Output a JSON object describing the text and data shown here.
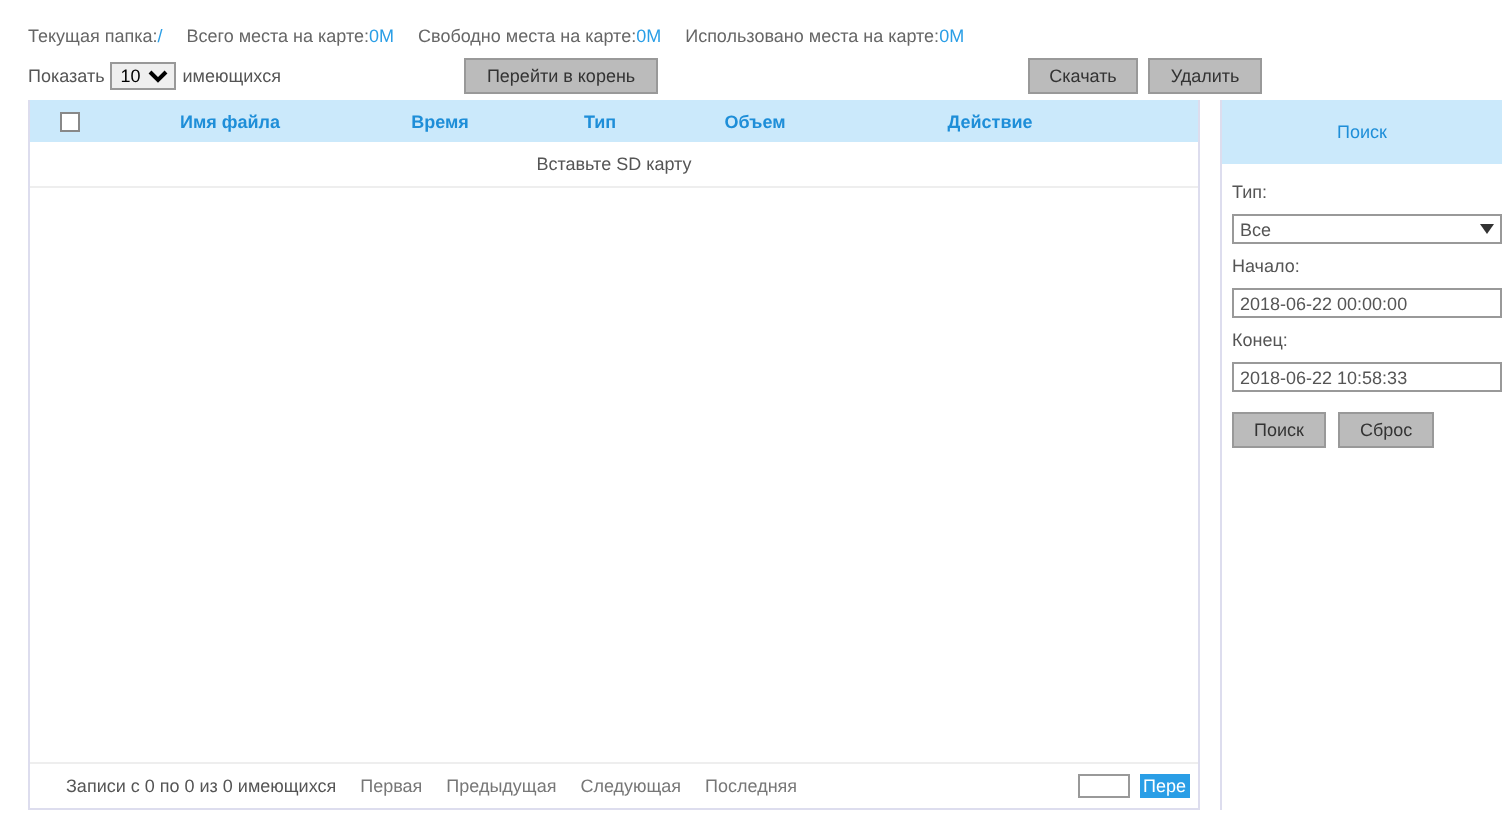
{
  "info": [
    {
      "label": "Текущая папка:",
      "value": "/"
    },
    {
      "label": "Всего места на карте:",
      "value": "0M"
    },
    {
      "label": "Свободно места на карте:",
      "value": "0M"
    },
    {
      "label": "Использовано места на карте:",
      "value": "0M"
    }
  ],
  "show": {
    "before": "Показать",
    "value": "10",
    "after": "имеющихся"
  },
  "buttons": {
    "root": "Перейти в корень",
    "download": "Скачать",
    "delete": "Удалить"
  },
  "table": {
    "select_all": {
      "checked": false
    },
    "columns": [
      "Имя файла",
      "Время",
      "Тип",
      "Объем",
      "Действие"
    ],
    "empty": "Вставьте SD карту"
  },
  "pager": {
    "summary": "Записи с 0 по 0 из 0 имеющихся",
    "links": [
      "Первая",
      "Предыдущая",
      "Следующая",
      "Последняя"
    ],
    "go": "Пере"
  },
  "search": {
    "title": "Поиск",
    "type_label": "Тип:",
    "type_value": "Все",
    "start_label": "Начало:",
    "start_value": "2018-06-22 00:00:00",
    "end_label": "Конец:",
    "end_value": "2018-06-22 10:58:33",
    "search_button": "Поиск",
    "reset_button": "Сброс"
  }
}
